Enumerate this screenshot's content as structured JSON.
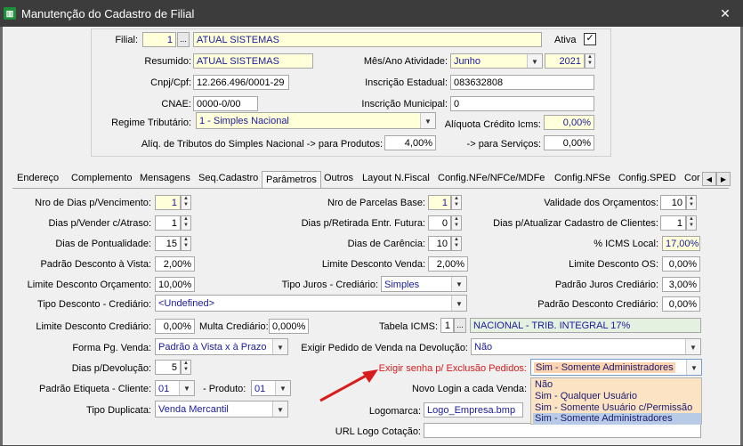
{
  "window": {
    "title": "Manutenção do Cadastro de Filial",
    "close": "✕"
  },
  "header": {
    "filial_label": "Filial:",
    "filial_code": "1",
    "filial_name": "ATUAL SISTEMAS",
    "ativa_label": "Ativa",
    "ativa_checked": "✓",
    "resumido_label": "Resumido:",
    "resumido": "ATUAL SISTEMAS",
    "mes_ano_label": "Mês/Ano Atividade:",
    "mes": "Junho",
    "ano": "2021",
    "cnpj_label": "Cnpj/Cpf:",
    "cnpj": "12.266.496/0001-29",
    "ie_label": "Inscrição Estadual:",
    "ie": "083632808",
    "cnae_label": "CNAE:",
    "cnae": "0000-0/00",
    "im_label": "Inscrição Municipal:",
    "im": "0",
    "regime_label": "Regime Tributário:",
    "regime": "1 - Simples Nacional",
    "aliquota_credito_label": "Alíquota Crédito Icms:",
    "aliquota_credito": "0,00%",
    "aliq_simples_label": "Alíq. de Tributos do Simples Nacional  -> para Produtos:",
    "aliq_produtos": "4,00%",
    "para_servicos_label": "-> para Serviços:",
    "aliq_servicos": "0,00%",
    "ellipsis": "..."
  },
  "tabs": [
    "Endereço",
    "Complemento",
    "Mensagens",
    "Seq.Cadastro",
    "Parâmetros",
    "Outros",
    "Layout N.Fiscal",
    "Config.NFe/NFCe/MDFe",
    "Config.NFSe",
    "Config.SPED",
    "Cor"
  ],
  "params": {
    "nro_dias_venc_label": "Nro de Dias p/Vencimento:",
    "nro_dias_venc": "1",
    "nro_parcelas_label": "Nro de Parcelas Base:",
    "nro_parcelas": "1",
    "validade_orc_label": "Validade dos Orçamentos:",
    "validade_orc": "10",
    "dias_vender_label": "Dias p/Vender c/Atraso:",
    "dias_vender": "1",
    "dias_retirada_label": "Dias p/Retirada Entr. Futura:",
    "dias_retirada": "0",
    "dias_atualizar_label": "Dias p/Atualizar Cadastro de Clientes:",
    "dias_atualizar": "1",
    "dias_pontualidade_label": "Dias de Pontualidade:",
    "dias_pontualidade": "15",
    "dias_carencia_label": "Dias de Carência:",
    "dias_carencia": "10",
    "icms_local_label": "% ICMS Local:",
    "icms_local": "17,00%",
    "padrao_desc_vista_label": "Padrão Desconto à Vista:",
    "padrao_desc_vista": "2,00%",
    "limite_desc_venda_label": "Limite Desconto Venda:",
    "limite_desc_venda": "2,00%",
    "limite_desc_os_label": "Limite Desconto OS:",
    "limite_desc_os": "0,00%",
    "limite_desc_orc_label": "Limite Desconto Orçamento:",
    "limite_desc_orc": "10,00%",
    "tipo_juros_label": "Tipo Juros - Crediário:",
    "tipo_juros": "Simples",
    "padrao_juros_cred_label": "Padrão Juros Crediário:",
    "padrao_juros_cred": "3,00%",
    "tipo_desc_cred_label": "Tipo Desconto - Crediário:",
    "tipo_desc_cred": "<Undefined>",
    "padrao_desc_cred_label": "Padrão Desconto Crediário:",
    "padrao_desc_cred": "0,00%",
    "limite_desc_cred_label": "Limite Desconto Crediário:",
    "limite_desc_cred": "0,00%",
    "multa_cred_label": "Multa Crediário:",
    "multa_cred": "0,000%",
    "tabela_icms_label": "Tabela ICMS:",
    "tabela_icms_code": "1",
    "tabela_icms_name": "NACIONAL - TRIB. INTEGRAL 17%",
    "forma_pg_label": "Forma Pg. Venda:",
    "forma_pg": "Padrão à Vista x à Prazo",
    "exigir_pedido_label": "Exigir Pedido de Venda na Devolução:",
    "exigir_pedido": "Não",
    "dias_devolucao_label": "Dias p/Devolução:",
    "dias_devolucao": "5",
    "exigir_senha_label": "Exigir senha p/ Exclusão Pedidos:",
    "exigir_senha": "Sim - Somente Administradores",
    "padrao_etiqueta_label": "Padrão Etiqueta - Cliente:",
    "etiqueta_cliente": "01",
    "produto_label": "-  Produto:",
    "etiqueta_produto": "01",
    "novo_login_label": "Novo Login a cada Venda:",
    "tipo_duplicata_label": "Tipo Duplicata:",
    "tipo_duplicata": "Venda Mercantil",
    "logomarca_label": "Logomarca:",
    "logomarca": "Logo_Empresa.bmp",
    "url_logo_label": "URL Logo Cotação:",
    "url_logo": ""
  },
  "dropdown_options": [
    "Não",
    "Sim - Qualquer Usuário",
    "Sim - Somente Usuário c/Permissão",
    "Sim - Somente Administradores"
  ],
  "colors": {
    "accent_red": "#d81c1c",
    "field_yellow": "#ffffd9",
    "popup_bg": "#fbe3c4",
    "selected": "#b8cbe6"
  }
}
